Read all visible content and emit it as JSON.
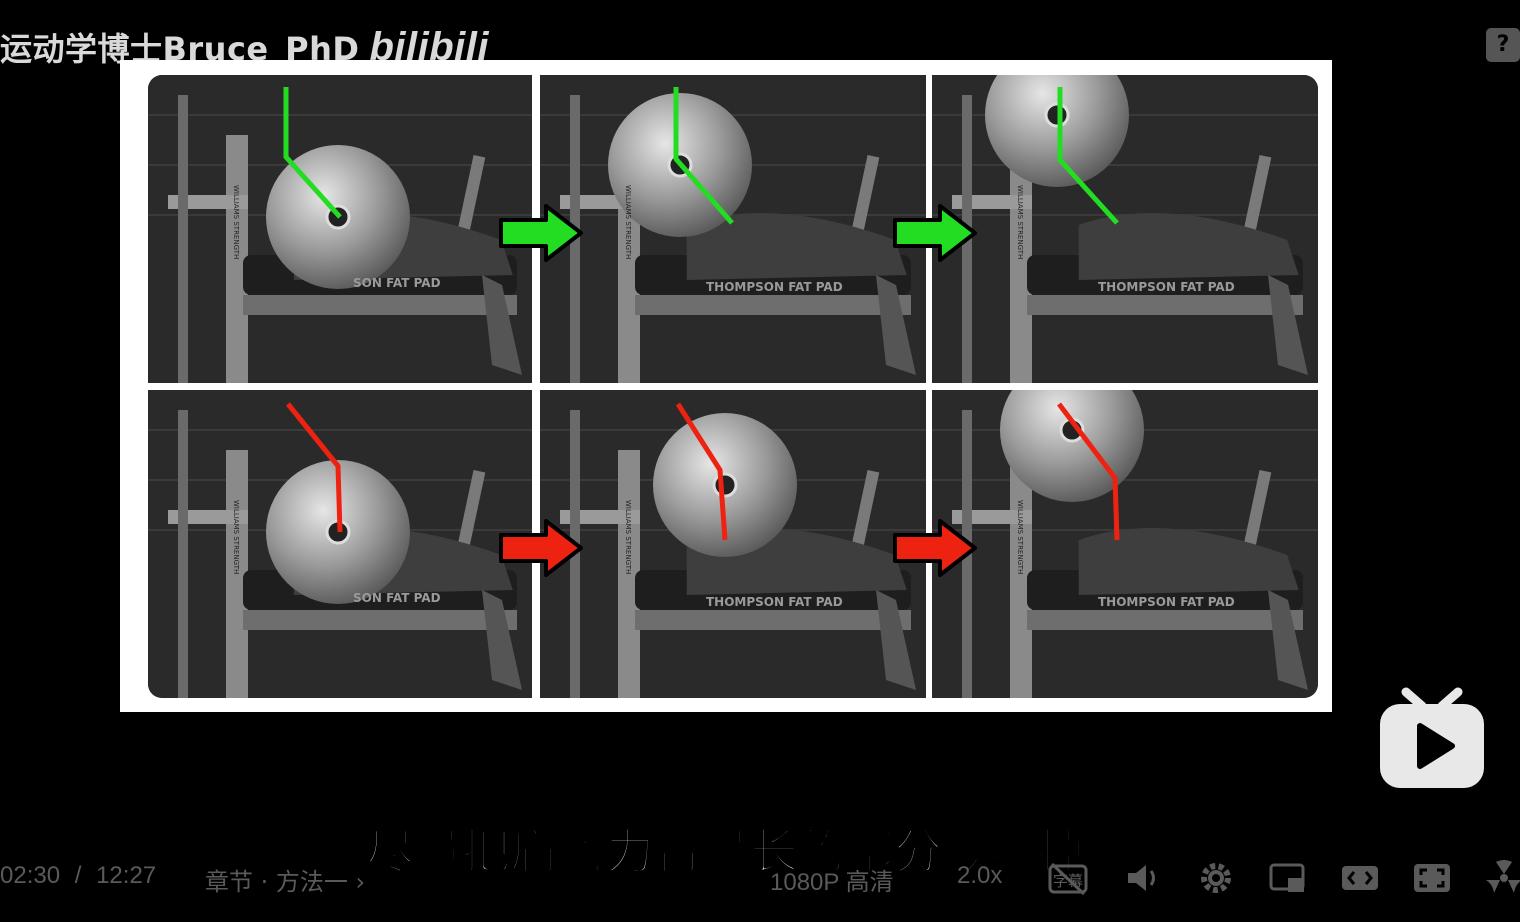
{
  "watermark": {
    "channel": "运动学博士Bruce_PhD",
    "logo": "bilibili"
  },
  "help_icon": "?",
  "panels": [
    {
      "row": "top",
      "arrow_color": "#22dd22",
      "pad_text": "SON FAT PAD"
    },
    {
      "row": "top",
      "arrow_color": "#22dd22",
      "pad_text": "THOMPSON FAT PAD"
    },
    {
      "row": "top",
      "arrow_color": "#22dd22",
      "pad_text": "THOMPSON FAT PAD"
    },
    {
      "row": "bottom",
      "arrow_color": "#ee2211",
      "pad_text": "SON FAT PAD"
    },
    {
      "row": "bottom",
      "arrow_color": "#ee2211",
      "pad_text": "THOMPSON FAT PAD"
    },
    {
      "row": "bottom",
      "arrow_color": "#ee2211",
      "pad_text": "THOMPSON FAT PAD"
    }
  ],
  "rack_label": "WILLIAMS STRENGTH",
  "subtitle": "尽量把肩膀力臂最长的部分取缔掉",
  "player": {
    "current_time": "02:30",
    "separator": "/",
    "duration": "12:27",
    "chapter": "章节 · 方法一",
    "quality": "1080P 高清",
    "speed": "2.0x",
    "subtitle_btn": "字幕"
  },
  "colors": {
    "good": "#22dd22",
    "bad": "#ee2211",
    "controls": "#5a5a5a"
  }
}
